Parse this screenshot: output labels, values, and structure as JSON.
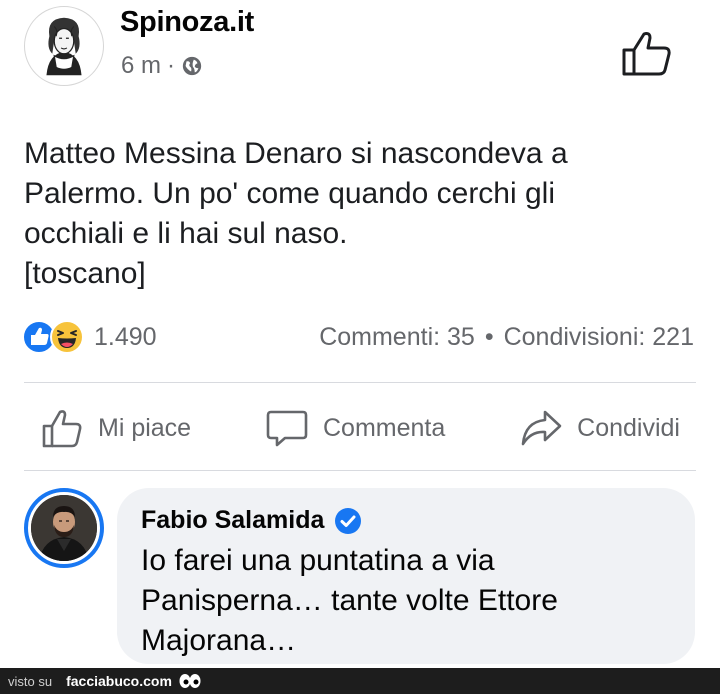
{
  "post": {
    "author": "Spinoza.it",
    "time": "6 m",
    "separator": "·",
    "text": "Matteo Messina Denaro si nascondeva a\nPalermo. Un po' come quando cerchi gli\nocchiali e li hai sul naso.\n[toscano]",
    "reaction_count": "1.490",
    "comments": "Commenti: 35",
    "dot": "•",
    "shares": "Condivisioni: 221"
  },
  "actions": {
    "like": "Mi piace",
    "comment": "Commenta",
    "share": "Condividi"
  },
  "comment": {
    "author": "Fabio Salamida",
    "text": "Io farei una puntatina a via Panisperna… tante volte Ettore Majorana…"
  },
  "footer": {
    "seen_on": "visto su",
    "site": "facciabuco.com"
  },
  "colors": {
    "accent": "#1877f2",
    "muted": "#65676b",
    "bubble": "#f0f2f5"
  },
  "icons": [
    "globe-icon",
    "thumbs-up-icon",
    "like-reaction-icon",
    "haha-reaction-icon",
    "comment-icon",
    "share-icon",
    "verified-icon",
    "eyes-icon"
  ]
}
